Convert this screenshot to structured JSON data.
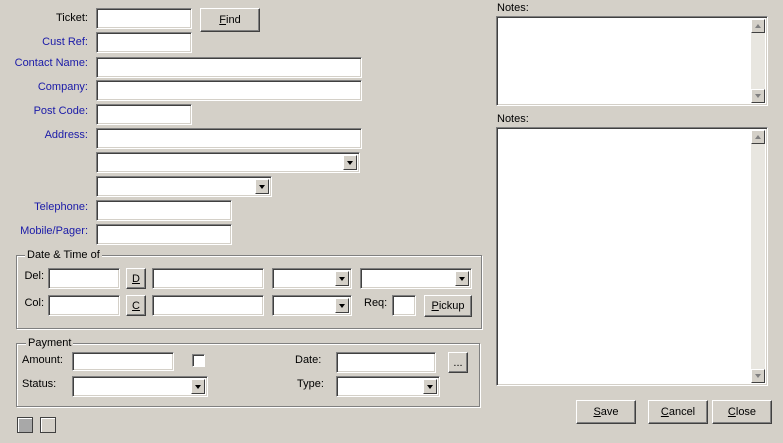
{
  "labels": {
    "ticket": "Ticket:",
    "cust_ref": "Cust Ref:",
    "contact_name": "Contact Name:",
    "company": "Company:",
    "post_code": "Post Code:",
    "address": "Address:",
    "telephone": "Telephone:",
    "mobile_pager": "Mobile/Pager:",
    "notes_top": "Notes:",
    "notes_bottom": "Notes:"
  },
  "buttons": {
    "find": "Find",
    "find_mnemonic": "F",
    "del_d": "D",
    "col_c": "C",
    "pickup": "Pickup",
    "pickup_mnemonic": "P",
    "date_picker": "...",
    "save": "Save",
    "save_mnemonic": "S",
    "cancel": "Cancel",
    "cancel_mnemonic": "C",
    "close": "Close",
    "close_mnemonic": "C"
  },
  "datetime_group": {
    "legend": "Date & Time of",
    "del_label": "Del:",
    "col_label": "Col:",
    "req_label": "Req:"
  },
  "payment_group": {
    "legend": "Payment",
    "amount_label": "Amount:",
    "status_label": "Status:",
    "date_label": "Date:",
    "type_label": "Type:"
  },
  "fields": {
    "ticket": "",
    "cust_ref": "",
    "contact_name": "",
    "company": "",
    "post_code": "",
    "address": "",
    "address_line2": "",
    "address_line3": "",
    "telephone": "",
    "mobile_pager": "",
    "del_date": "",
    "del_time": "",
    "del_combo1": "",
    "del_combo2": "",
    "col_date": "",
    "col_time": "",
    "col_combo1": "",
    "req": "",
    "amount": "",
    "status": "",
    "pay_date": "",
    "type": ""
  },
  "colors": {
    "background": "#d4d0c8",
    "label_blue": "#1a1aa8"
  }
}
